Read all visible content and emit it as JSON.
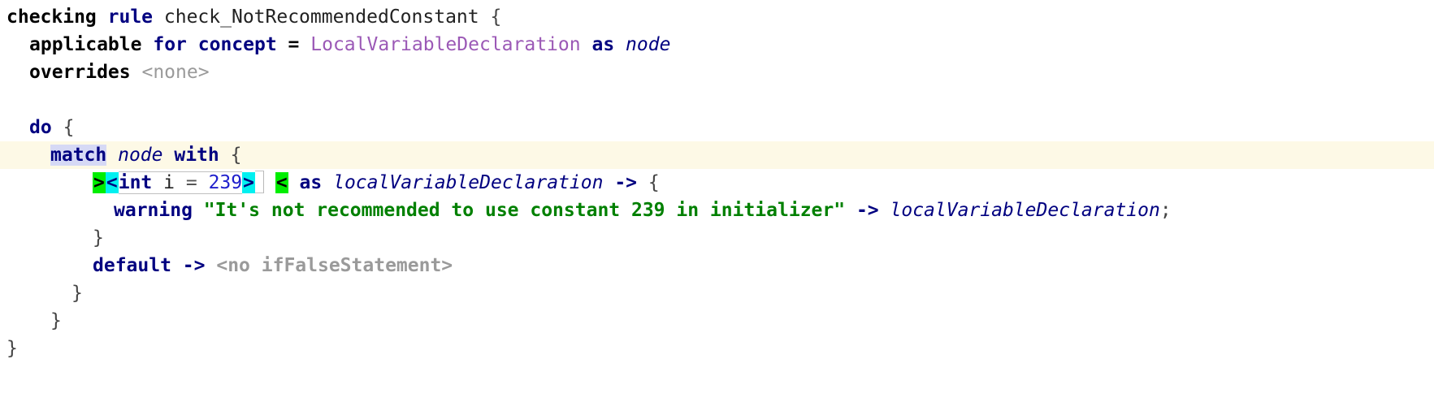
{
  "editor": {
    "type": "mps-projectional-code-editor",
    "font_size_px": 23,
    "line_height_px": 34,
    "background": "#ffffff",
    "caret_line_background": "#fdf9e6",
    "selection_background": "#d6d9f5",
    "colors": {
      "keyword": "#000080",
      "concept_reference": "#9b59b6",
      "string_literal": "#008000",
      "number_literal": "#2020cc",
      "placeholder_gray": "#9a9a9a",
      "variable_italic": "#000080",
      "antiquotation_green": "#00ee00",
      "antiquotation_cyan": "#00f0f0",
      "plain_text": "#3c3c3c"
    }
  },
  "code": {
    "line1": {
      "kw_checking": "checking",
      "kw_rule": "rule",
      "rule_name": "check_NotRecommendedConstant",
      "open_brace": "{"
    },
    "line2": {
      "kw_applicable": "applicable",
      "kw_for": "for",
      "kw_concept": "concept",
      "equals": "=",
      "concept_value": "LocalVariableDeclaration",
      "kw_as": "as",
      "alias": "node"
    },
    "line3": {
      "kw_overrides": "overrides",
      "value": "<none>"
    },
    "line4_blank": "",
    "line5": {
      "kw_do": "do",
      "open_brace": "{"
    },
    "line6": {
      "kw_match": "match",
      "subject": "node",
      "kw_with": "with",
      "open_brace": "{"
    },
    "line7": {
      "marker_green_open": ">",
      "marker_cyan_open": "<",
      "pattern_type": "int",
      "pattern_var": "i",
      "pattern_equals": "=",
      "pattern_value": "239",
      "marker_cyan_close": ">",
      "marker_green_close": "<",
      "kw_as": "as",
      "binding": "localVariableDeclaration",
      "arrow": "->",
      "open_brace": "{"
    },
    "line8": {
      "kw_warning": "warning",
      "message": "\"It's not recommended to use constant 239 in initializer\"",
      "arrow": "->",
      "target": "localVariableDeclaration",
      "semicolon": ";"
    },
    "line9": {
      "close_brace": "}"
    },
    "line10": {
      "kw_default": "default",
      "arrow": "->",
      "placeholder": "<no ifFalseStatement>"
    },
    "line11": {
      "close_brace": "}"
    },
    "line12": {
      "close_brace": "}"
    },
    "line13": {
      "close_brace": "}"
    }
  }
}
